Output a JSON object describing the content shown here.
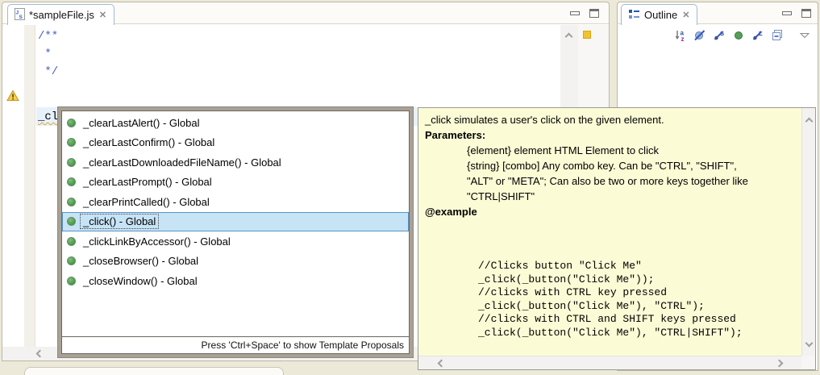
{
  "editor": {
    "tab": {
      "title": "*sampleFile.js"
    },
    "code_comment_lines": [
      "/**",
      " *",
      " */"
    ],
    "current_line_text": "_cl",
    "has_warning_marker": true
  },
  "completion": {
    "items": [
      {
        "label": "_clearLastAlert() - Global",
        "selected": false
      },
      {
        "label": "_clearLastConfirm() - Global",
        "selected": false
      },
      {
        "label": "_clearLastDownloadedFileName() - Global",
        "selected": false
      },
      {
        "label": "_clearLastPrompt() - Global",
        "selected": false
      },
      {
        "label": "_clearPrintCalled() - Global",
        "selected": false
      },
      {
        "label": "_click() - Global",
        "selected": true
      },
      {
        "label": "_clickLinkByAccessor() - Global",
        "selected": false
      },
      {
        "label": "_closeBrowser() - Global",
        "selected": false
      },
      {
        "label": "_closeWindow() - Global",
        "selected": false
      }
    ],
    "status_hint": "Press 'Ctrl+Space' to show Template Proposals"
  },
  "doc": {
    "description": "_click simulates a user's click on the given element.",
    "parameters_heading": "Parameters:",
    "parameter_lines": [
      "{element} element HTML Element to click",
      "{string} [combo] Any combo key. Can be \"CTRL\", \"SHIFT\",",
      "\"ALT\" or \"META\"; Can also be two or more keys together like",
      "\"CTRL|SHIFT\""
    ],
    "example_heading": "@example",
    "example_code_lines": [
      "//Clicks button \"Click Me\"",
      "_click(_button(\"Click Me\"));",
      "//clicks with CTRL key pressed",
      "_click(_button(\"Click Me\"), \"CTRL\");",
      "//clicks with CTRL and SHIFT keys pressed",
      "_click(_button(\"Click Me\"), \"CTRL|SHIFT\");"
    ]
  },
  "outline": {
    "title": "Outline",
    "toolbar_icons": [
      "sort-icon",
      "hide-globals-icon",
      "hide-static-icon",
      "show-fields-icon",
      "hide-locals-icon",
      "collapse-all-icon",
      "view-menu-icon"
    ]
  },
  "icons": {
    "close_glyph": "✕"
  },
  "colors": {
    "background": "#ece9d8",
    "doc_popup_bg": "#fbfbd6",
    "popup_border": "#a9a196",
    "selection_bg": "#c7e3f6",
    "selection_border": "#5795c6",
    "current_line": "#e7f1fb",
    "comment_text": "#4a5fc8",
    "warning_yellow": "#f2c230",
    "method_icon_green": "#4f9e51"
  }
}
